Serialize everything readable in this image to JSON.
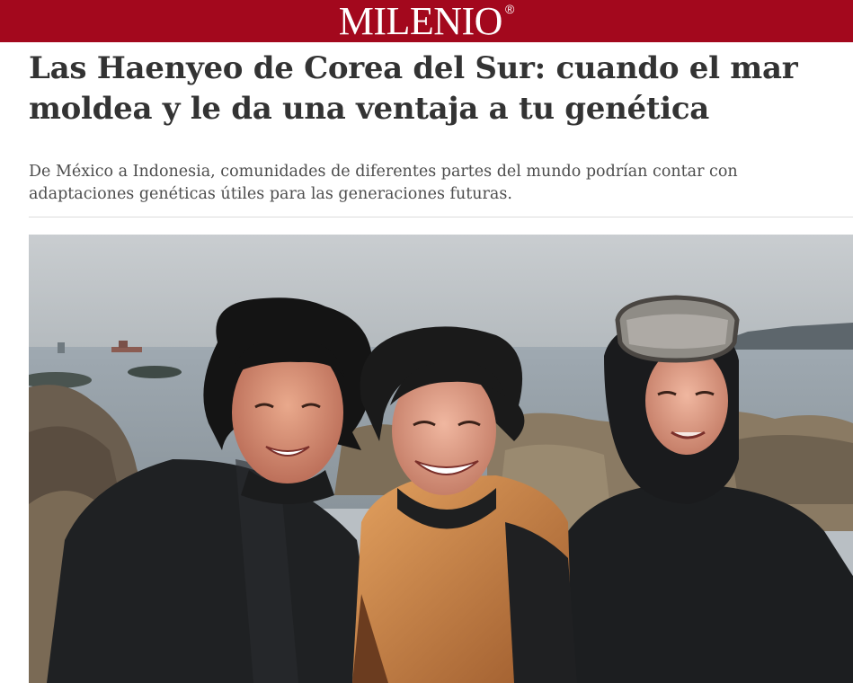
{
  "masthead": {
    "logo_text": "MILENIO",
    "registered_mark": "®",
    "brand_color": "#a3081d"
  },
  "article": {
    "headline": "Las Haenyeo de Corea del Sur: cuando el mar moldea y le da una ventaja a tu genética",
    "subheadline": "De México a Indonesia, comunidades de diferentes partes del mundo podrían contar con adaptaciones genéticas útiles para las generaciones futuras."
  },
  "photo": {
    "icon": "photo-three-smiling-divers-by-sea"
  }
}
